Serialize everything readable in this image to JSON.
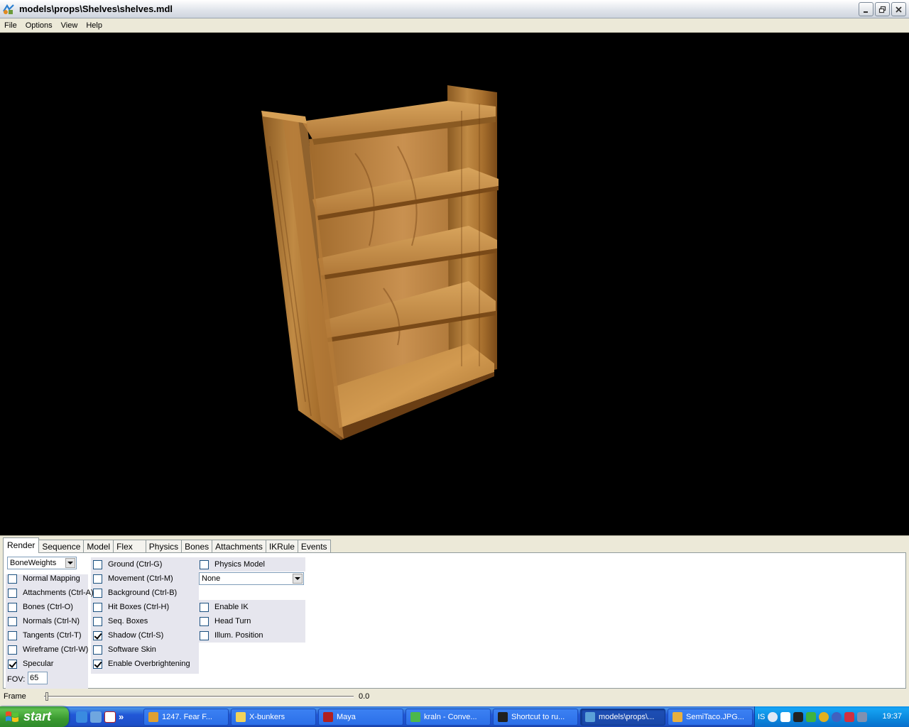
{
  "window": {
    "title": "models\\props\\Shelves\\shelves.mdl"
  },
  "menu": [
    "File",
    "Options",
    "View",
    "Help"
  ],
  "tabs": [
    "Render",
    "Sequence",
    "Model",
    "Flex",
    "Physics",
    "Bones",
    "Attachments",
    "IKRule",
    "Events"
  ],
  "render": {
    "render_mode": "BoneWeights",
    "col1": [
      {
        "label": "Normal Mapping",
        "checked": false
      },
      {
        "label": "Attachments (Ctrl-A)",
        "checked": false
      },
      {
        "label": "Bones (Ctrl-O)",
        "checked": false
      },
      {
        "label": "Normals (Ctrl-N)",
        "checked": false
      },
      {
        "label": "Tangents (Ctrl-T)",
        "checked": false
      },
      {
        "label": "Wireframe (Ctrl-W)",
        "checked": false
      },
      {
        "label": "Specular",
        "checked": true
      }
    ],
    "col2": [
      {
        "label": "Ground (Ctrl-G)",
        "checked": false
      },
      {
        "label": "Movement (Ctrl-M)",
        "checked": false
      },
      {
        "label": "Background (Ctrl-B)",
        "checked": false
      },
      {
        "label": "Hit Boxes (Ctrl-H)",
        "checked": false
      },
      {
        "label": "Seq. Boxes",
        "checked": false
      },
      {
        "label": "Shadow (Ctrl-S)",
        "checked": true
      },
      {
        "label": "Software Skin",
        "checked": false
      },
      {
        "label": "Enable Overbrightening",
        "checked": true
      }
    ],
    "physics_model_label": "Physics Model",
    "physics_select": "None",
    "col3": [
      {
        "label": "Enable IK",
        "checked": false
      },
      {
        "label": "Head Turn",
        "checked": false
      },
      {
        "label": "Illum. Position",
        "checked": false
      }
    ],
    "fov_label": "FOV:",
    "fov_value": "65"
  },
  "frame": {
    "label": "Frame",
    "value": "0.0"
  },
  "taskbar": {
    "start": "start",
    "chevron": "»",
    "tasks": [
      {
        "label": "1247. Fear F...",
        "active": false,
        "color": "#e0a030"
      },
      {
        "label": "X-bunkers",
        "active": false,
        "color": "#f2d35a"
      },
      {
        "label": "Maya",
        "active": false,
        "color": "#b02020"
      },
      {
        "label": "kraln - Conve...",
        "active": false,
        "color": "#4cb84c"
      },
      {
        "label": "Shortcut to ru...",
        "active": false,
        "color": "#202020"
      },
      {
        "label": "models\\props\\...",
        "active": true,
        "color": "#5aa0d8"
      },
      {
        "label": "SemiTaco.JPG...",
        "active": false,
        "color": "#e8b040"
      }
    ],
    "lang": "IS",
    "clock": "19:37"
  }
}
